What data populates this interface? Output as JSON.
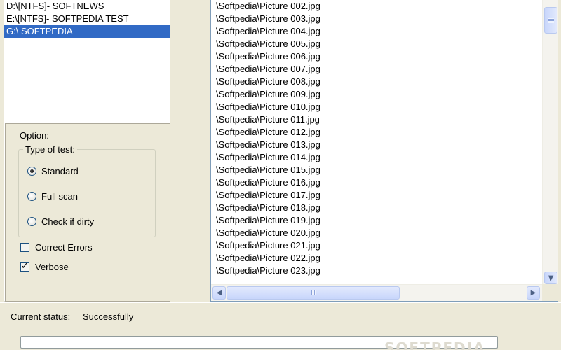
{
  "drives": [
    {
      "label": "D:\\[NTFS]- SOFTNEWS",
      "selected": false
    },
    {
      "label": "E:\\[NTFS]- SOFTPEDIA TEST",
      "selected": false
    },
    {
      "label": "G:\\ SOFTPEDIA",
      "selected": true
    }
  ],
  "options": {
    "title": "Option:",
    "test_type_legend": "Type of test:",
    "radios": [
      {
        "label": "Standard",
        "checked": true
      },
      {
        "label": "Full scan",
        "checked": false
      },
      {
        "label": "Check if dirty",
        "checked": false
      }
    ],
    "checkboxes": [
      {
        "label": "Correct Errors",
        "checked": false
      },
      {
        "label": "Verbose",
        "checked": true
      }
    ]
  },
  "files": [
    "\\Softpedia\\Picture 002.jpg",
    "\\Softpedia\\Picture 003.jpg",
    "\\Softpedia\\Picture 004.jpg",
    "\\Softpedia\\Picture 005.jpg",
    "\\Softpedia\\Picture 006.jpg",
    "\\Softpedia\\Picture 007.jpg",
    "\\Softpedia\\Picture 008.jpg",
    "\\Softpedia\\Picture 009.jpg",
    "\\Softpedia\\Picture 010.jpg",
    "\\Softpedia\\Picture 011.jpg",
    "\\Softpedia\\Picture 012.jpg",
    "\\Softpedia\\Picture 013.jpg",
    "\\Softpedia\\Picture 014.jpg",
    "\\Softpedia\\Picture 015.jpg",
    "\\Softpedia\\Picture 016.jpg",
    "\\Softpedia\\Picture 017.jpg",
    "\\Softpedia\\Picture 018.jpg",
    "\\Softpedia\\Picture 019.jpg",
    "\\Softpedia\\Picture 020.jpg",
    "\\Softpedia\\Picture 021.jpg",
    "\\Softpedia\\Picture 022.jpg",
    "\\Softpedia\\Picture 023.jpg"
  ],
  "status": {
    "label": "Current status:",
    "value": "Successfully",
    "progress_percent": 0
  },
  "watermark": "SOFTPEDIA",
  "colors": {
    "selection": "#316ac5",
    "window_bg": "#ece9d8"
  },
  "icons": {
    "scroll_down": "chevron-down-icon",
    "scroll_left": "chevron-left-icon",
    "scroll_right": "chevron-right-icon"
  }
}
